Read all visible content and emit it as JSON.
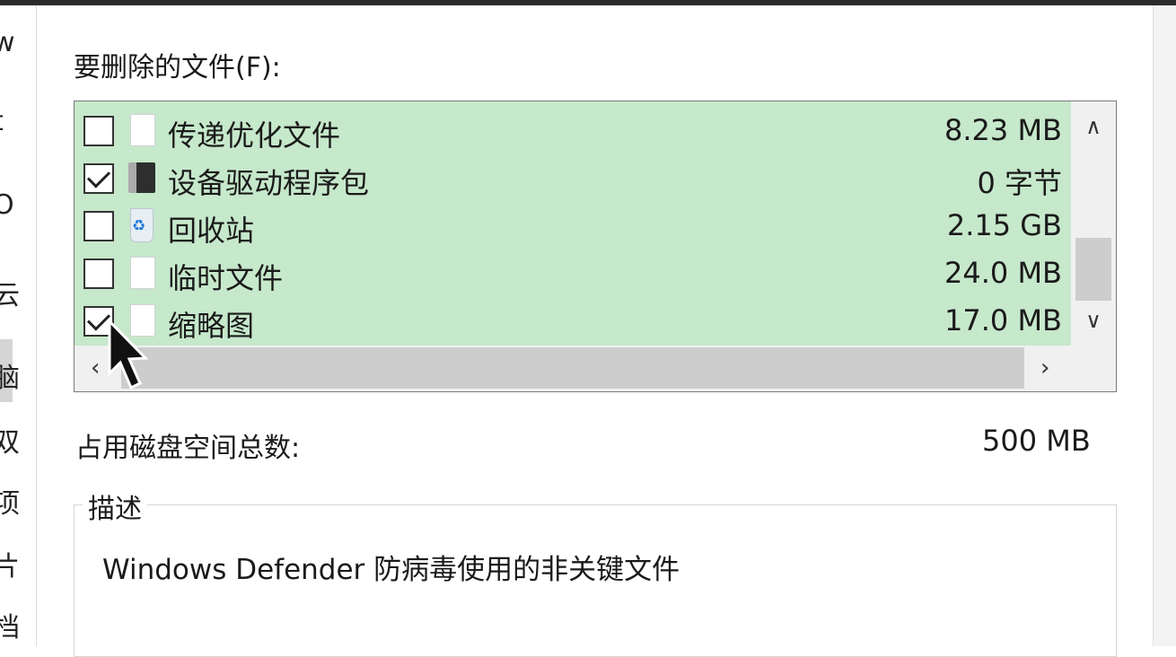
{
  "files_label": "要删除的文件(F):",
  "items": [
    {
      "name": "传递优化文件",
      "size": "8.23 MB",
      "checked": false,
      "icon": "file-icon"
    },
    {
      "name": "设备驱动程序包",
      "size": "0 字节",
      "checked": true,
      "icon": "driver-package-icon"
    },
    {
      "name": "回收站",
      "size": "2.15 GB",
      "checked": false,
      "icon": "recycle-bin-icon"
    },
    {
      "name": "临时文件",
      "size": "24.0 MB",
      "checked": false,
      "icon": "file-icon"
    },
    {
      "name": "缩略图",
      "size": "17.0 MB",
      "checked": true,
      "icon": "file-icon"
    }
  ],
  "total": {
    "label": "占用磁盘空间总数:",
    "value": "500 MB"
  },
  "description": {
    "label": "描述",
    "text": "Windows Defender 防病毒使用的非关键文件"
  },
  "scroll_glyphs": {
    "up": "∧",
    "down": "∨",
    "left": "‹",
    "right": "›"
  },
  "left_panel_glyphs": [
    "w",
    "t",
    "O",
    "云",
    "脑",
    "双",
    "项",
    "片",
    "档"
  ],
  "colors": {
    "list_background": "#c6e8cb",
    "scrollbar": "#f0f0f0",
    "scroll_thumb": "#cdcdcd",
    "border": "#7a7a7a"
  }
}
